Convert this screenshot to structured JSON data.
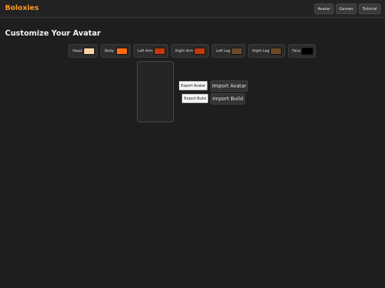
{
  "app": {
    "brand": "Boloxies",
    "nav": [
      "Avatar",
      "Games",
      "Tutorial"
    ],
    "accent_color": "#ff9a1f"
  },
  "page": {
    "title": "Customize Your Avatar"
  },
  "parts": [
    {
      "label": "Head",
      "color": "#fcd2a7"
    },
    {
      "label": "Body",
      "color": "#ff6c12"
    },
    {
      "label": "Left Arm",
      "color": "#c2390c"
    },
    {
      "label": "Right Arm",
      "color": "#c2390c"
    },
    {
      "label": "Left Leg",
      "color": "#6b4a2a"
    },
    {
      "label": "Right Leg",
      "color": "#6b4a2a"
    },
    {
      "label": "Face",
      "color": "#000000"
    }
  ],
  "actions": {
    "export_avatar": "Export Avatar",
    "import_avatar": "Import Avatar",
    "export_build": "Export Build",
    "import_build": "Import Build"
  }
}
